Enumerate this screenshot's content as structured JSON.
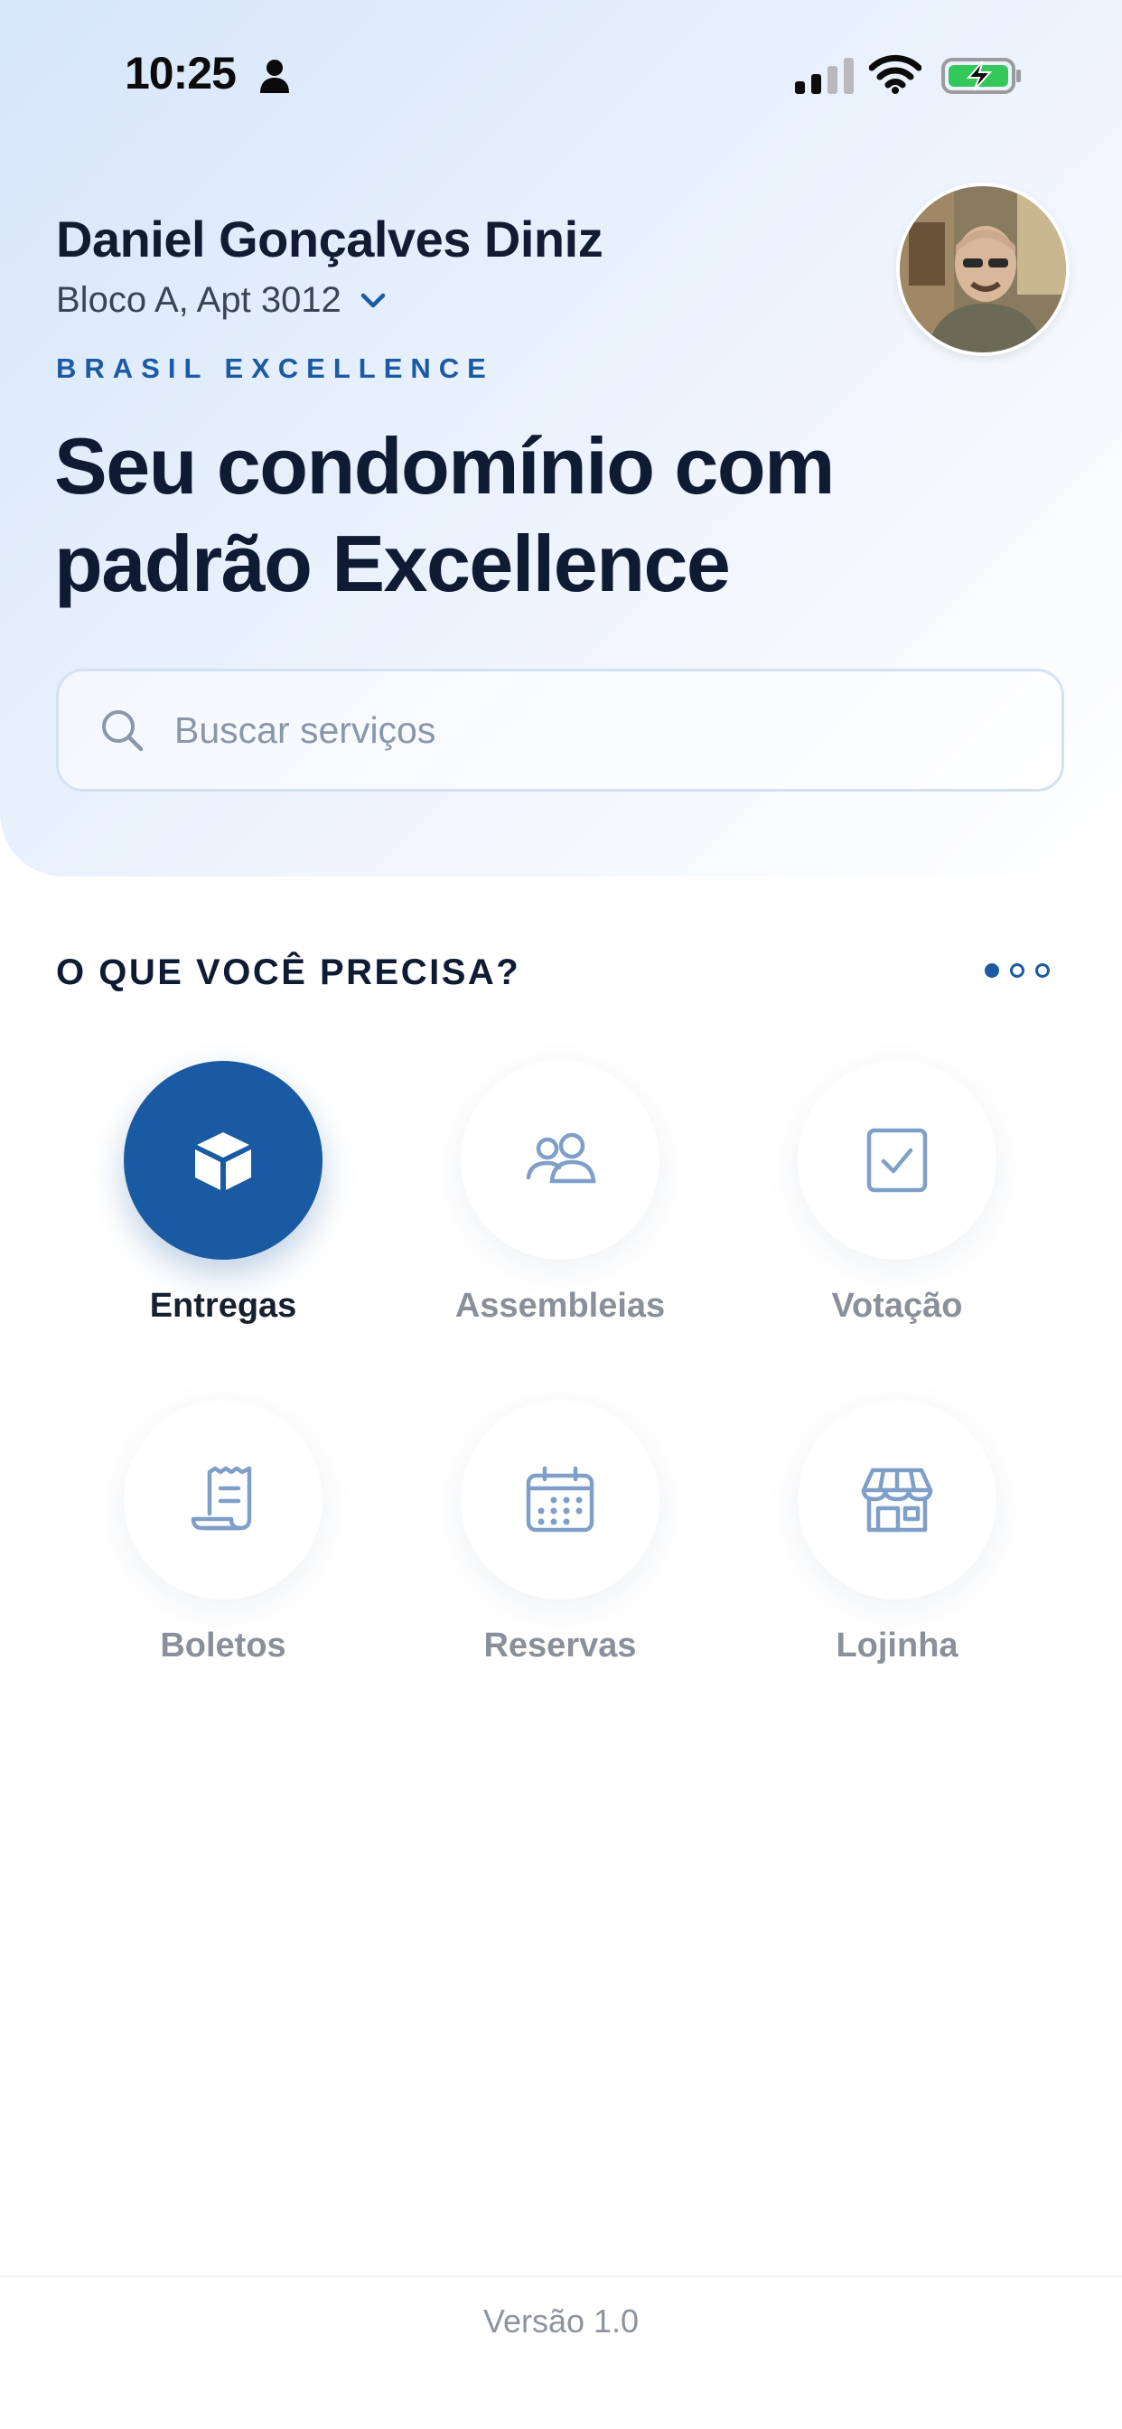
{
  "status_bar": {
    "time": "10:25",
    "battery_state": "charging",
    "icons": [
      "person-icon",
      "cellular-signal-icon",
      "wifi-icon",
      "battery-charging-icon"
    ]
  },
  "user": {
    "name": "Daniel Gonçalves Diniz",
    "unit": "Bloco A, Apt 3012"
  },
  "brand": "BRASIL EXCELLENCE",
  "headline": {
    "line1": "Seu condomínio com",
    "line2": "padrão Excellence"
  },
  "search": {
    "placeholder": "Buscar serviços",
    "value": ""
  },
  "services_section": {
    "title": "O QUE VOCÊ PRECISA?",
    "page_count": 3,
    "active_page": 1
  },
  "services": [
    {
      "label": "Entregas",
      "icon": "package-box-icon",
      "active": true
    },
    {
      "label": "Assembleias",
      "icon": "users-group-icon",
      "active": false
    },
    {
      "label": "Votação",
      "icon": "checkbox-vote-icon",
      "active": false
    },
    {
      "label": "Boletos",
      "icon": "receipt-scroll-icon",
      "active": false
    },
    {
      "label": "Reservas",
      "icon": "calendar-icon",
      "active": false
    },
    {
      "label": "Lojinha",
      "icon": "store-icon",
      "active": false
    }
  ],
  "footer": {
    "version": "Versão 1.0"
  },
  "colors": {
    "primary": "#1a5aa2",
    "brand_text": "#1c5aa3",
    "icon_inactive": "#7f9fc8",
    "label_inactive": "#8a909a",
    "header_gradient_start": "#d6e6fb"
  }
}
